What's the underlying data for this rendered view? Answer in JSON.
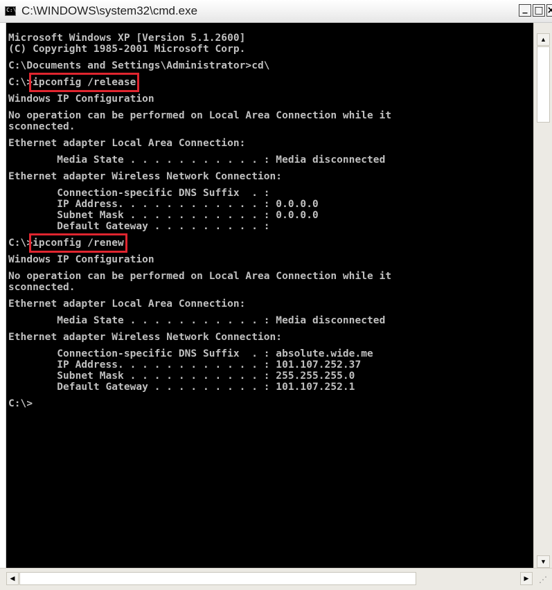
{
  "window": {
    "title": "C:\\WINDOWS\\system32\\cmd.exe",
    "app_icon_text": "C:\\",
    "minimize_glyph": "_",
    "maximize_glyph": "□",
    "close_glyph": "×"
  },
  "console": {
    "lines": [
      "Microsoft Windows XP [Version 5.1.2600]",
      "(C) Copyright 1985-2001 Microsoft Corp.",
      "",
      "C:\\Documents and Settings\\Administrator>cd\\",
      "",
      "C:\\>ipconfig /release",
      "",
      "Windows IP Configuration",
      "",
      "No operation can be performed on Local Area Connection while it",
      "sconnected.",
      "",
      "Ethernet adapter Local Area Connection:",
      "",
      "        Media State . . . . . . . . . . . : Media disconnected",
      "",
      "Ethernet adapter Wireless Network Connection:",
      "",
      "        Connection-specific DNS Suffix  . :",
      "        IP Address. . . . . . . . . . . . : 0.0.0.0",
      "        Subnet Mask . . . . . . . . . . . : 0.0.0.0",
      "        Default Gateway . . . . . . . . . :",
      "",
      "C:\\>ipconfig /renew",
      "",
      "Windows IP Configuration",
      "",
      "No operation can be performed on Local Area Connection while it",
      "sconnected.",
      "",
      "Ethernet adapter Local Area Connection:",
      "",
      "        Media State . . . . . . . . . . . : Media disconnected",
      "",
      "Ethernet adapter Wireless Network Connection:",
      "",
      "        Connection-specific DNS Suffix  . : absolute.wide.me",
      "        IP Address. . . . . . . . . . . . : 101.107.252.37",
      "        Subnet Mask . . . . . . . . . . . : 255.255.255.0",
      "        Default Gateway . . . . . . . . . : 101.107.252.1",
      "",
      "C:\\>"
    ],
    "highlighted_commands": [
      "ipconfig /release",
      "ipconfig /renew"
    ],
    "text_color": "#c0c0c0",
    "background_color": "#000000",
    "highlight_color": "#e0252f"
  },
  "scrollbars": {
    "up_arrow": "▲",
    "down_arrow": "▼",
    "left_arrow": "◀",
    "right_arrow": "▶",
    "grip_glyph": "⋰"
  }
}
